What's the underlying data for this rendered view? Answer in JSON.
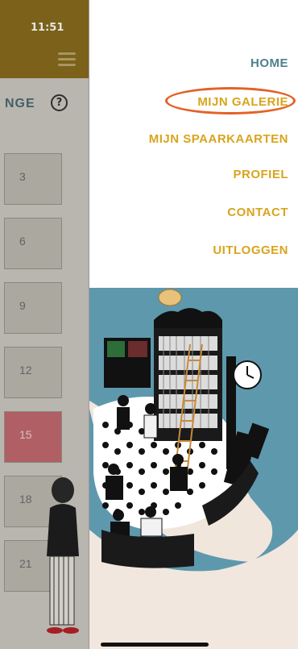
{
  "status_bar": {
    "time": "11:51"
  },
  "background_page": {
    "title_fragment": "NGE",
    "help_symbol": "?",
    "cards": [
      "3",
      "6",
      "9",
      "12",
      "15",
      "18",
      "21"
    ],
    "highlighted_card": "15"
  },
  "menu": {
    "items": [
      {
        "label": "HOME"
      },
      {
        "label": "MIJN GALERIE"
      },
      {
        "label": "MIJN SPAARKAARTEN"
      },
      {
        "label": "PROFIEL"
      },
      {
        "label": "CONTACT"
      },
      {
        "label": "UITLOGGEN"
      }
    ],
    "circled_item": "MIJN GALERIE"
  },
  "colors": {
    "menu_active": "#4f7f8f",
    "menu_item": "#d9a41d",
    "annotation_circle": "#e46127",
    "illustration_bg": "#5e98ad",
    "header_bg": "#8a6d1c"
  }
}
